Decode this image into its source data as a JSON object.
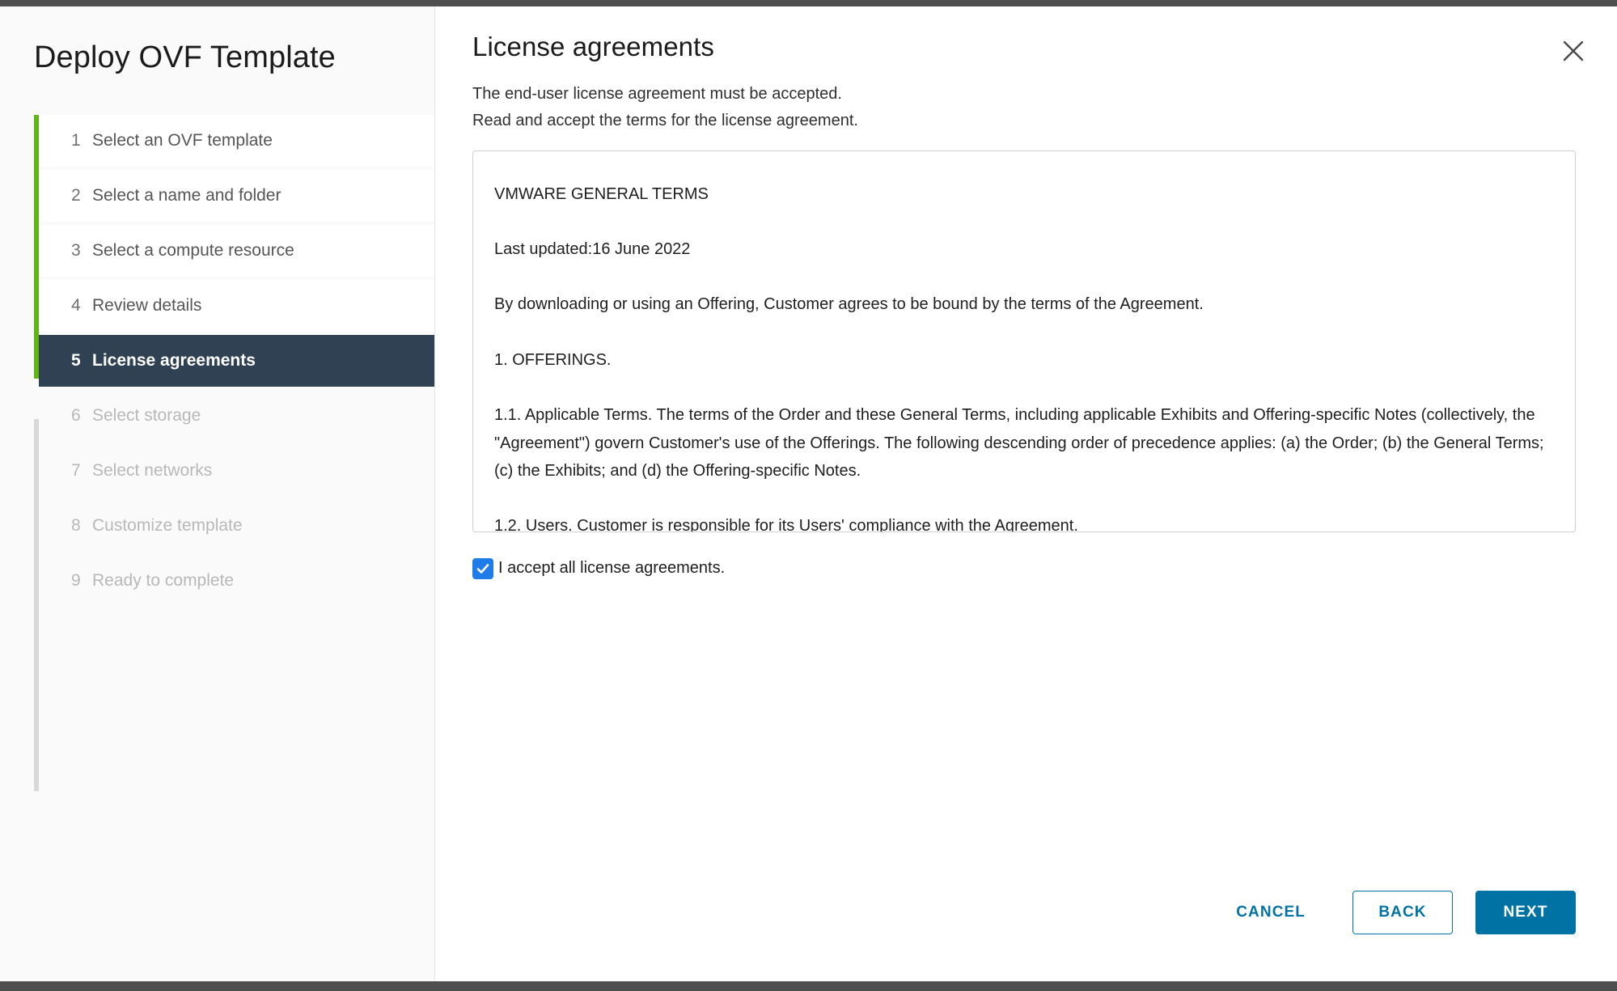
{
  "chrome": {
    "top_strip": "",
    "bottom_strip": ""
  },
  "wizard": {
    "title": "Deploy OVF Template",
    "steps": [
      {
        "number": "1",
        "label": "Select an OVF template",
        "state": "done"
      },
      {
        "number": "2",
        "label": "Select a name and folder",
        "state": "done"
      },
      {
        "number": "3",
        "label": "Select a compute resource",
        "state": "done"
      },
      {
        "number": "4",
        "label": "Review details",
        "state": "done"
      },
      {
        "number": "5",
        "label": "License agreements",
        "state": "active"
      },
      {
        "number": "6",
        "label": "Select storage",
        "state": "disabled"
      },
      {
        "number": "7",
        "label": "Select networks",
        "state": "disabled"
      },
      {
        "number": "8",
        "label": "Customize template",
        "state": "disabled"
      },
      {
        "number": "9",
        "label": "Ready to complete",
        "state": "disabled"
      }
    ]
  },
  "content": {
    "title": "License agreements",
    "subtitle_line1": "The end-user license agreement must be accepted.",
    "subtitle_line2": "Read and accept the terms for the license agreement.",
    "close_icon": "close-icon",
    "license": {
      "paragraphs": [
        "VMWARE GENERAL TERMS",
        "Last updated:16 June 2022",
        "By downloading or using an Offering, Customer agrees to be bound by the terms of the Agreement.",
        "1. OFFERINGS.",
        "1.1. Applicable Terms. The terms of the Order and these General Terms, including applicable Exhibits and Offering-specific Notes (collectively, the \"Agreement\") govern Customer's use of the Offerings. The following descending order of precedence applies: (a) the Order; (b) the General Terms; (c) the Exhibits; and (d) the Offering-specific Notes.",
        "1.2. Users. Customer is responsible for its Users' compliance with the Agreement."
      ]
    },
    "accept": {
      "label": "I accept all license agreements.",
      "checked": true,
      "check_icon": "checkmark-icon"
    }
  },
  "footer": {
    "cancel_label": "CANCEL",
    "back_label": "BACK",
    "next_label": "NEXT"
  },
  "colors": {
    "progress_done": "#60b515",
    "progress_todo": "#d8d8d8",
    "active_step_bg": "#2f4152",
    "action_blue": "#0072a3",
    "checkbox_blue": "#1f7ce8"
  }
}
